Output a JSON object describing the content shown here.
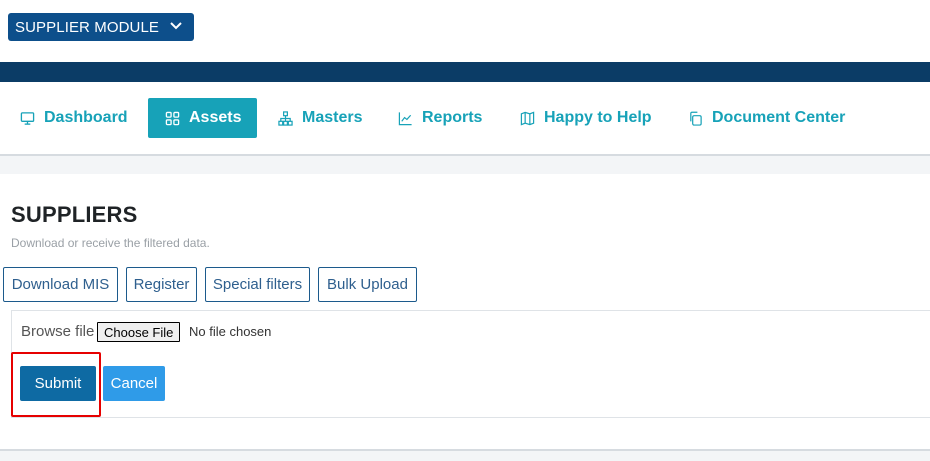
{
  "module_select": {
    "label": "SUPPLIER MODULE",
    "icon": "chevron-down-icon"
  },
  "nav": {
    "items": [
      {
        "label": "Dashboard",
        "icon": "monitor-icon"
      },
      {
        "label": "Assets",
        "icon": "grid-icon",
        "active": true
      },
      {
        "label": "Masters",
        "icon": "sitemap-icon"
      },
      {
        "label": "Reports",
        "icon": "line-chart-icon"
      },
      {
        "label": "Happy to Help",
        "icon": "map-icon"
      },
      {
        "label": "Document Center",
        "icon": "copy-icon"
      }
    ]
  },
  "page": {
    "title": "SUPPLIERS",
    "subtitle": "Download or receive the filtered data."
  },
  "actions": {
    "download_mis": "Download MIS",
    "register": "Register",
    "special_filters": "Special filters",
    "bulk_upload": "Bulk Upload"
  },
  "upload": {
    "browse_label": "Browse file",
    "choose_file": "Choose File",
    "no_file": "No file chosen",
    "submit": "Submit",
    "cancel": "Cancel"
  },
  "colors": {
    "brand_dark": "#0b3c66",
    "module_blue": "#0d4f8b",
    "accent_teal": "#17a2b8",
    "submit_blue": "#0e6aa3",
    "cancel_blue": "#2f9be8",
    "highlight_red": "#e60000"
  }
}
